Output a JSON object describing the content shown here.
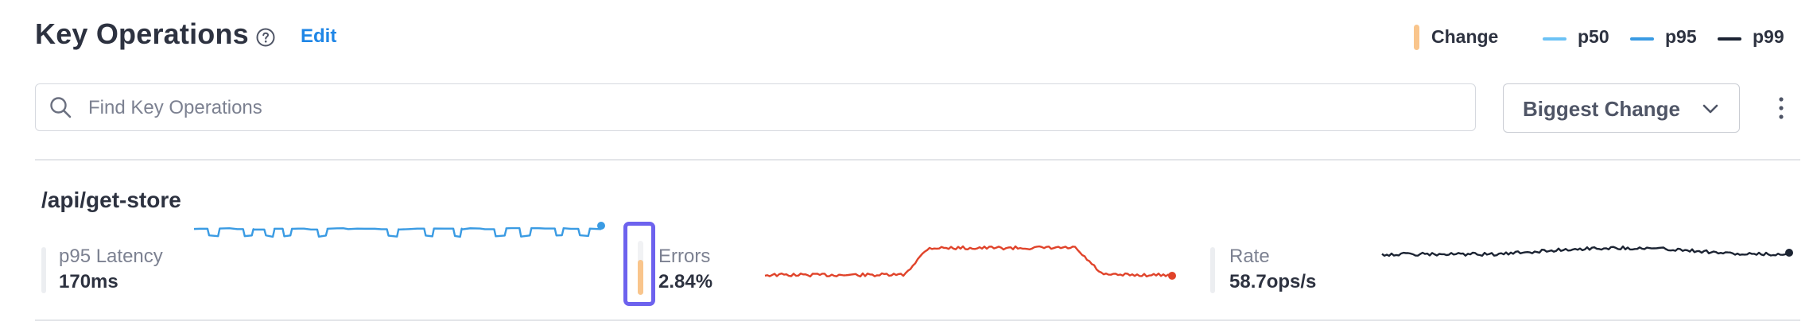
{
  "header": {
    "title": "Key Operations",
    "edit_label": "Edit"
  },
  "legend": {
    "change_label": "Change",
    "p50_label": "p50",
    "p95_label": "p95",
    "p99_label": "p99",
    "colors": {
      "change": "#f9c58c",
      "p50": "#6cc2f5",
      "p95": "#3a9be3",
      "p99": "#1c2433"
    }
  },
  "search": {
    "placeholder": "Find Key Operations",
    "value": ""
  },
  "sort": {
    "selected": "Biggest Change"
  },
  "operation": {
    "name": "/api/get-store",
    "latency": {
      "label": "p95 Latency",
      "value": "170ms",
      "color": "#3a9be3"
    },
    "errors": {
      "label": "Errors",
      "value": "2.84%",
      "color": "#e0432a"
    },
    "rate": {
      "label": "Rate",
      "value": "58.7ops/s",
      "color": "#1c2433"
    },
    "change_level": 0.65
  }
}
